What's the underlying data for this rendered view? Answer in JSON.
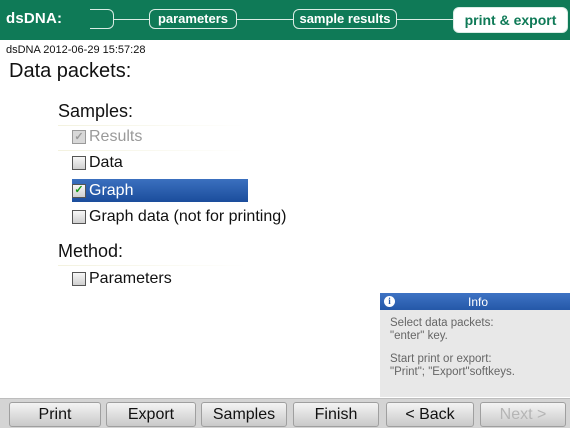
{
  "header": {
    "app_title": "dsDNA:",
    "steps": {
      "empty": "",
      "parameters": "parameters",
      "sample_results": "sample results",
      "print_export": "print & export"
    },
    "active_step": "print & export",
    "colors": {
      "bar": "#0f7a57",
      "active_text": "#0f7a57"
    }
  },
  "content": {
    "stamp": "dsDNA 2012-06-29 15:57:28",
    "title": "Data packets:",
    "samples": {
      "heading": "Samples:",
      "options": [
        {
          "label": "Results",
          "checked": true,
          "disabled": true,
          "selected": false
        },
        {
          "label": "Data",
          "checked": false,
          "disabled": false,
          "selected": false
        },
        {
          "label": "Graph",
          "checked": true,
          "disabled": false,
          "selected": true
        },
        {
          "label": "Graph data (not for printing)",
          "checked": false,
          "disabled": false,
          "selected": false
        }
      ]
    },
    "method": {
      "heading": "Method:",
      "options": [
        {
          "label": "Parameters",
          "checked": false,
          "disabled": false,
          "selected": false
        }
      ]
    },
    "selection_color": "#2a5fb0"
  },
  "info": {
    "icon": "info-icon",
    "title": "Info",
    "line1": "Select data packets:",
    "line2": "\"enter\" key.",
    "line3": "Start print or export:",
    "line4": "\"Print\"; \"Export\"softkeys."
  },
  "softkeys": {
    "print": "Print",
    "export": "Export",
    "samples": "Samples",
    "finish": "Finish",
    "back": "< Back",
    "next": "Next >"
  }
}
